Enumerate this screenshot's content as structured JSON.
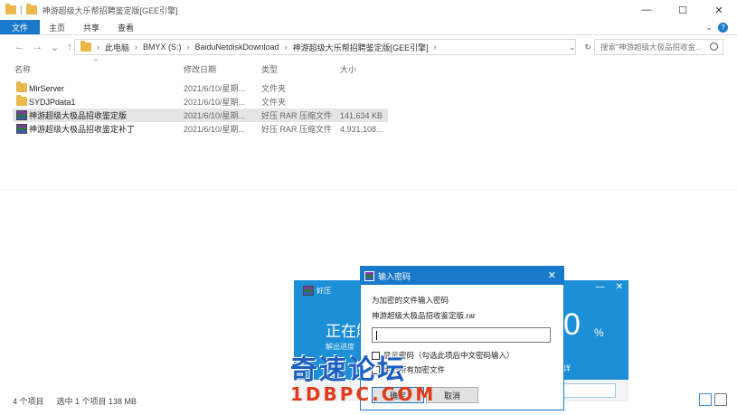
{
  "window": {
    "title": "神游超级大乐帮招聘鉴定版[GEE引擎]",
    "minimize": "—",
    "maximize": "☐",
    "close": "✕"
  },
  "ribbon": {
    "tabs": [
      "文件",
      "主页",
      "共享",
      "查看"
    ],
    "expand": "⌄",
    "help": "?"
  },
  "nav": {
    "back": "←",
    "forward": "→",
    "recent": "⌄",
    "up": "↑"
  },
  "address": {
    "crumbs": [
      "此电脑",
      "BMYX (S:)",
      "BaiduNetdiskDownload",
      "神游超级大乐帮招聘鉴定版[GEE引擎]"
    ],
    "dropdown": "⌄",
    "refresh": "↻"
  },
  "search": {
    "placeholder": "搜索\"神游超级大极品招收金..."
  },
  "columns": {
    "name": "名称",
    "date": "修改日期",
    "type": "类型",
    "size": "大小",
    "sort_indicator": "^"
  },
  "files": [
    {
      "name": "MirServer",
      "date": "2021/6/10/星期...",
      "type": "文件夹",
      "size": "",
      "icon": "folder-icon",
      "selected": false
    },
    {
      "name": "SYDJPdata1",
      "date": "2021/6/10/星期...",
      "type": "文件夹",
      "size": "",
      "icon": "folder-icon",
      "selected": false
    },
    {
      "name": "神游超级大极品招收鉴定版",
      "date": "2021/6/10/星期...",
      "type": "好压 RAR 压缩文件",
      "size": "141,634 KB",
      "icon": "rar-icon",
      "selected": true
    },
    {
      "name": "神游超级大极品招收鉴定补丁",
      "date": "2021/6/10/星期...",
      "type": "好压 RAR 压缩文件",
      "size": "4,931,108...",
      "icon": "rar-icon",
      "selected": false
    }
  ],
  "statusbar": {
    "count": "4 个项目",
    "selection": "选中 1 个项目 138 MB"
  },
  "installer": {
    "brand": "好压",
    "status": "正在解",
    "sub": "解出进度",
    "percent": "0",
    "percent_sign": "%",
    "more": "详"
  },
  "password_dialog": {
    "title": "输入密码",
    "close": "✕",
    "prompt": "为加密的文件输入密码",
    "filename": "神游超级大极品招收鉴定版.rar",
    "show_password": "显示密码（勾选此项后中文密码输入）",
    "apply_all": "用于所有加密文件",
    "ok": "确定",
    "cancel": "取消"
  },
  "watermark": {
    "line1": "奇速论坛",
    "line2": "1DBPC.COM"
  }
}
